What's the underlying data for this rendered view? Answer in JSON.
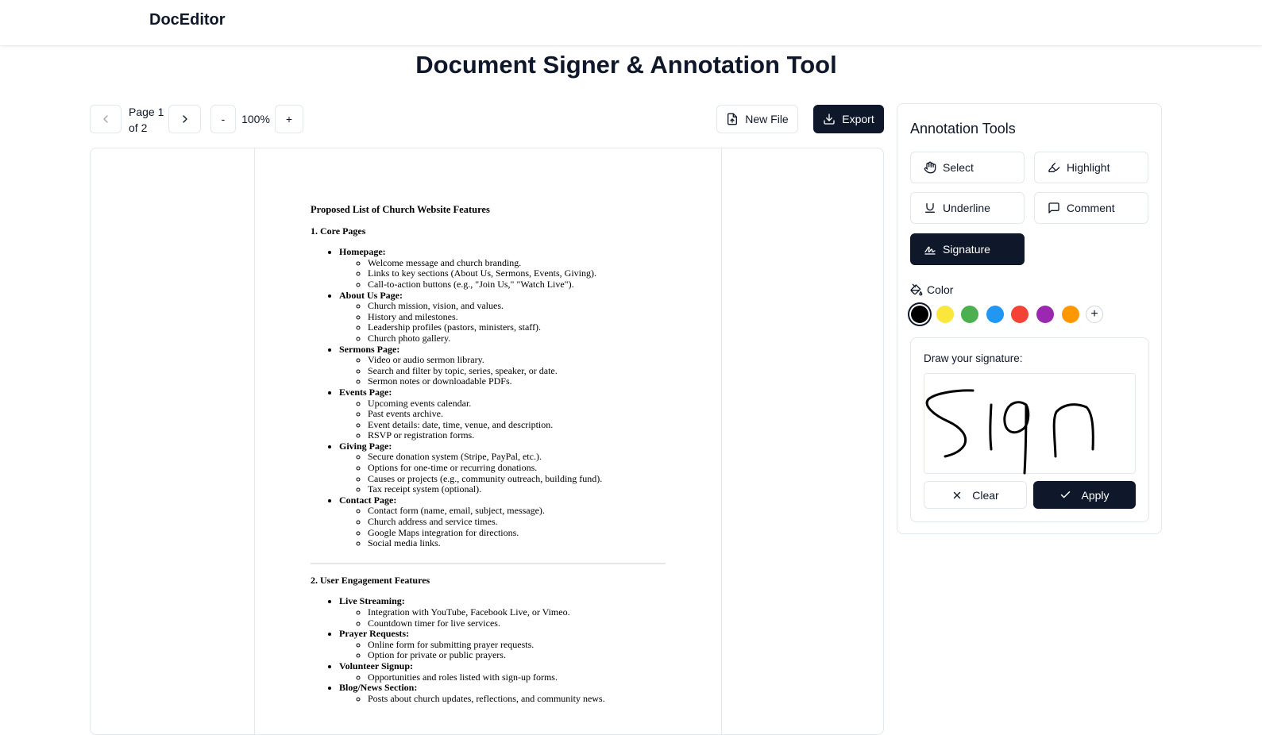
{
  "app": {
    "brand": "DocEditor",
    "title": "Document Signer & Annotation Tool"
  },
  "toolbar": {
    "page_line1": "Page 1",
    "page_line2": "of 2",
    "zoom_out": "-",
    "zoom_level": "100%",
    "zoom_in": "+",
    "new_file": "New File",
    "export": "Export"
  },
  "document": {
    "title": "Proposed List of Church Website Features",
    "section1_title": "1. Core Pages",
    "section1_items": [
      {
        "label": "Homepage:",
        "subs": [
          "Welcome message and church branding.",
          "Links to key sections (About Us, Sermons, Events, Giving).",
          "Call-to-action buttons (e.g., \"Join Us,\" \"Watch Live\")."
        ]
      },
      {
        "label": "About Us Page:",
        "subs": [
          "Church mission, vision, and values.",
          "History and milestones.",
          "Leadership profiles (pastors, ministers, staff).",
          "Church photo gallery."
        ]
      },
      {
        "label": "Sermons Page:",
        "subs": [
          "Video or audio sermon library.",
          "Search and filter by topic, series, speaker, or date.",
          "Sermon notes or downloadable PDFs."
        ]
      },
      {
        "label": "Events Page:",
        "subs": [
          "Upcoming events calendar.",
          "Past events archive.",
          "Event details: date, time, venue, and description.",
          "RSVP or registration forms."
        ]
      },
      {
        "label": "Giving Page:",
        "subs": [
          "Secure donation system (Stripe, PayPal, etc.).",
          "Options for one-time or recurring donations.",
          "Causes or projects (e.g., community outreach, building fund).",
          "Tax receipt system (optional)."
        ]
      },
      {
        "label": "Contact Page:",
        "subs": [
          "Contact form (name, email, subject, message).",
          "Church address and service times.",
          "Google Maps integration for directions.",
          "Social media links."
        ]
      }
    ],
    "section2_title": "2. User Engagement Features",
    "section2_items": [
      {
        "label": "Live Streaming:",
        "subs": [
          "Integration with YouTube, Facebook Live, or Vimeo.",
          "Countdown timer for live services."
        ]
      },
      {
        "label": "Prayer Requests:",
        "subs": [
          "Online form for submitting prayer requests.",
          "Option for private or public prayers."
        ]
      },
      {
        "label": "Volunteer Signup:",
        "subs": [
          "Opportunities and roles listed with sign-up forms."
        ]
      },
      {
        "label": "Blog/News Section:",
        "subs": [
          "Posts about church updates, reflections, and community news."
        ]
      }
    ]
  },
  "panel": {
    "title": "Annotation Tools",
    "tools": {
      "select": "Select",
      "highlight": "Highlight",
      "underline": "Underline",
      "comment": "Comment",
      "signature": "Signature"
    },
    "active_tool": "signature",
    "color_label": "Color",
    "colors": [
      "#000000",
      "#fbe73b",
      "#4caf50",
      "#2196f3",
      "#f44336",
      "#9c27b0",
      "#ff9800"
    ],
    "selected_color": "#000000",
    "add_color": "+",
    "signature_prompt": "Draw your signature:",
    "signature_drawn_text": "Sign",
    "clear": "Clear",
    "apply": "Apply"
  }
}
